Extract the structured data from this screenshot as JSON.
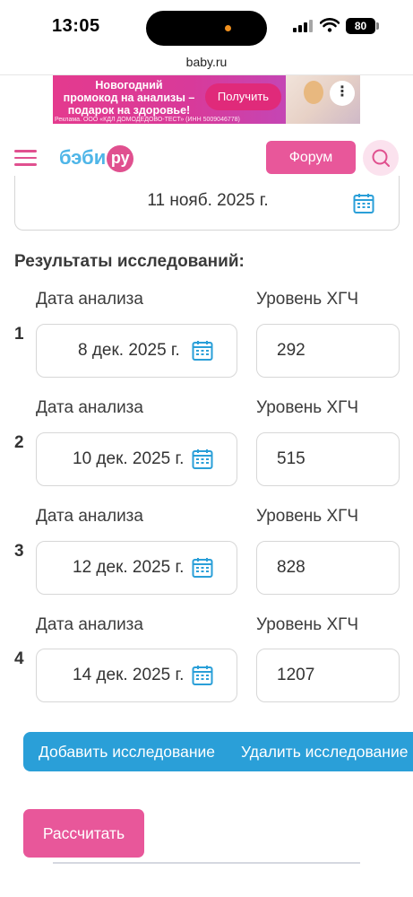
{
  "status_bar": {
    "time": "13:05",
    "battery": "80"
  },
  "browser": {
    "url": "baby.ru"
  },
  "ad": {
    "text_line1": "Новогодний",
    "text_line2": "промокод на анализы –",
    "text_line3": "подарок на здоровье!",
    "button_label": "Получить",
    "more_label": "⋮",
    "legal": "Реклама. ООО «КДЛ ДОМОДЕДОВО-ТЕСТ» (ИНН 5009046778)"
  },
  "header": {
    "logo_main": "бэби",
    "logo_ru": "ру",
    "forum_label": "Форум"
  },
  "top_date": {
    "value": "11 нояб. 2025 г."
  },
  "results": {
    "title": "Результаты исследований:",
    "date_label": "Дата анализа",
    "level_label": "Уровень ХГЧ",
    "rows": [
      {
        "num": "1",
        "date": "8 дек. 2025 г.",
        "level": "292"
      },
      {
        "num": "2",
        "date": "10 дек. 2025 г.",
        "level": "515"
      },
      {
        "num": "3",
        "date": "12 дек. 2025 г.",
        "level": "828"
      },
      {
        "num": "4",
        "date": "14 дек. 2025 г.",
        "level": "1207"
      }
    ]
  },
  "actions": {
    "add_label": "Добавить исследование",
    "delete_label": "Удалить исследование",
    "calculate_label": "Рассчитать"
  },
  "colors": {
    "brand_pink": "#e8579a",
    "brand_blue": "#2a9fd8",
    "logo_blue": "#4fb6e8"
  }
}
